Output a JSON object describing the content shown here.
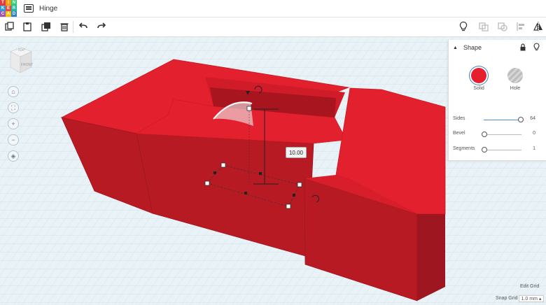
{
  "logo": {
    "letters": [
      "T",
      "I",
      "N",
      "K",
      "E",
      "R",
      "C",
      "A",
      "D"
    ],
    "colors": [
      "#e03b3b",
      "#f39c12",
      "#2ecc71",
      "#3498db",
      "#e74c3c",
      "#1abc9c",
      "#9b59b6",
      "#f1c40f",
      "#2c82c9"
    ]
  },
  "header": {
    "title": "Hinge"
  },
  "toolbar": {
    "copy_icon": "copy-icon",
    "paste_icon": "paste-icon",
    "duplicate_icon": "duplicate-icon",
    "delete_icon": "trash-icon",
    "undo_icon": "undo-icon",
    "redo_icon": "redo-icon",
    "note_icon": "lightbulb-icon",
    "group_icon": "group-icon",
    "ungroup_icon": "ungroup-icon",
    "align_icon": "align-icon",
    "mirror_icon": "mirror-icon"
  },
  "viewcube": {
    "top": "TOP",
    "front": "FRONT"
  },
  "nav": [
    "home-icon",
    "fit-icon",
    "zoom-in-icon",
    "zoom-out-icon",
    "orthographic-icon"
  ],
  "inspector": {
    "title": "Shape",
    "solid_label": "Solid",
    "hole_label": "Hole",
    "solid_color": "#e51f2c",
    "sides": {
      "label": "Sides",
      "value": "64",
      "fraction": 1.0
    },
    "bevel": {
      "label": "Bevel",
      "value": "0",
      "fraction": 0.0
    },
    "segments": {
      "label": "Segments",
      "value": "1",
      "fraction": 0.0
    }
  },
  "dimension": {
    "height_value": "10.00"
  },
  "grid": {
    "edit_label": "Edit Grid",
    "snap_label": "Snap Grid",
    "snap_value": "1.0 mm ▴"
  },
  "colors": {
    "face_front": "#b81a24",
    "face_top": "#e3202d",
    "face_dark": "#9e1720",
    "grid_line": "#cfe0ea"
  }
}
